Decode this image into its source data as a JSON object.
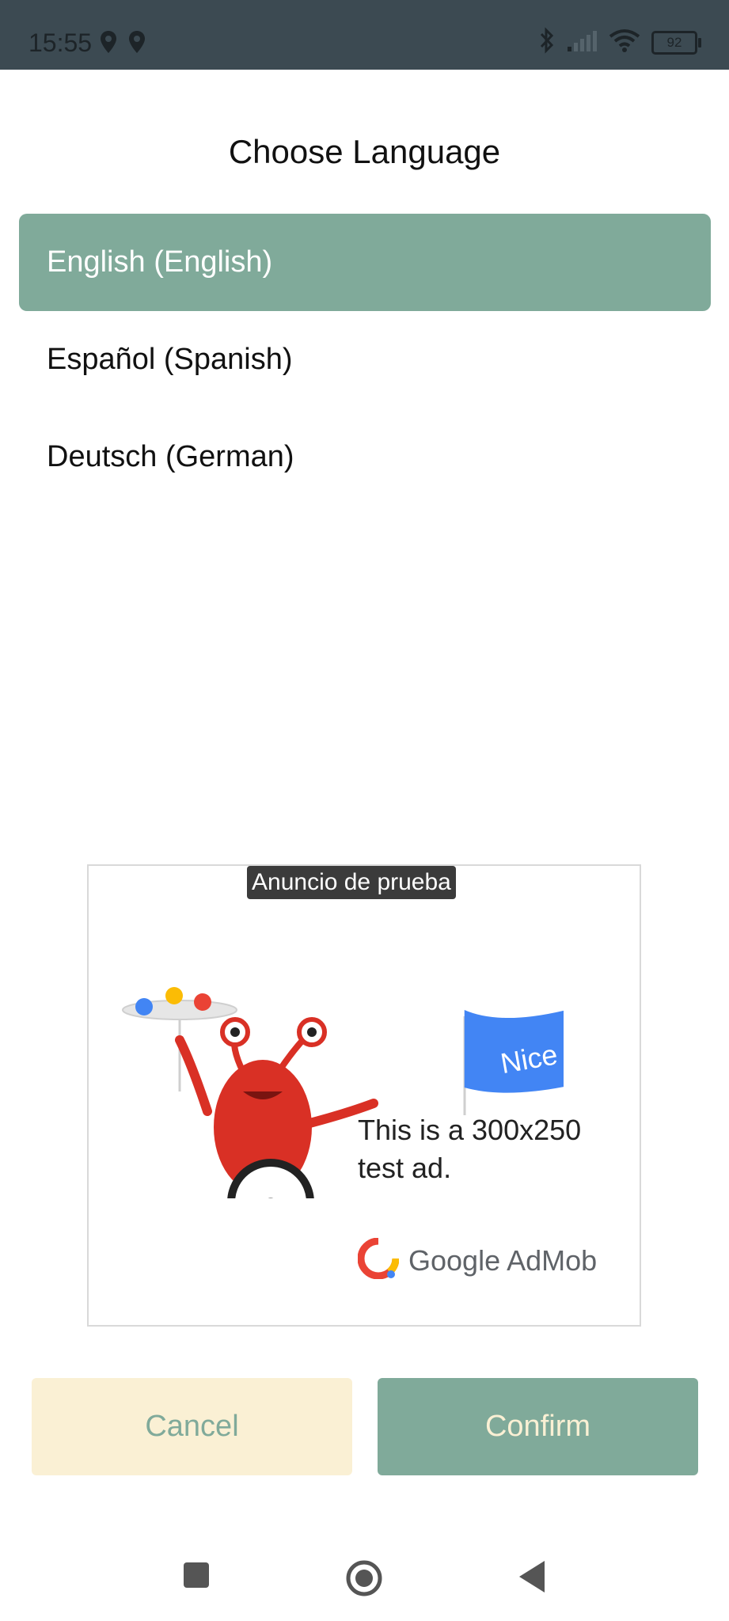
{
  "status_bar": {
    "time": "15:55",
    "battery": "92",
    "icons": [
      "location-icon",
      "location-icon",
      "bluetooth-icon",
      "signal-icon",
      "wifi-icon",
      "battery-icon"
    ]
  },
  "dialog": {
    "title": "Choose Language",
    "languages": [
      {
        "label": "English (English)",
        "selected": true
      },
      {
        "label": "Español (Spanish)",
        "selected": false
      },
      {
        "label": "Deutsch (German)",
        "selected": false
      }
    ],
    "accent_color": "#80aa9a",
    "cancel_label": "Cancel",
    "confirm_label": "Confirm"
  },
  "ad": {
    "label": "Anuncio de prueba",
    "banner_text": "Nice job!",
    "text": "This is a 300x250 test ad.",
    "brand": "Google AdMob"
  },
  "nav": {
    "icons": [
      "recent-apps-icon",
      "home-icon",
      "back-icon"
    ]
  }
}
